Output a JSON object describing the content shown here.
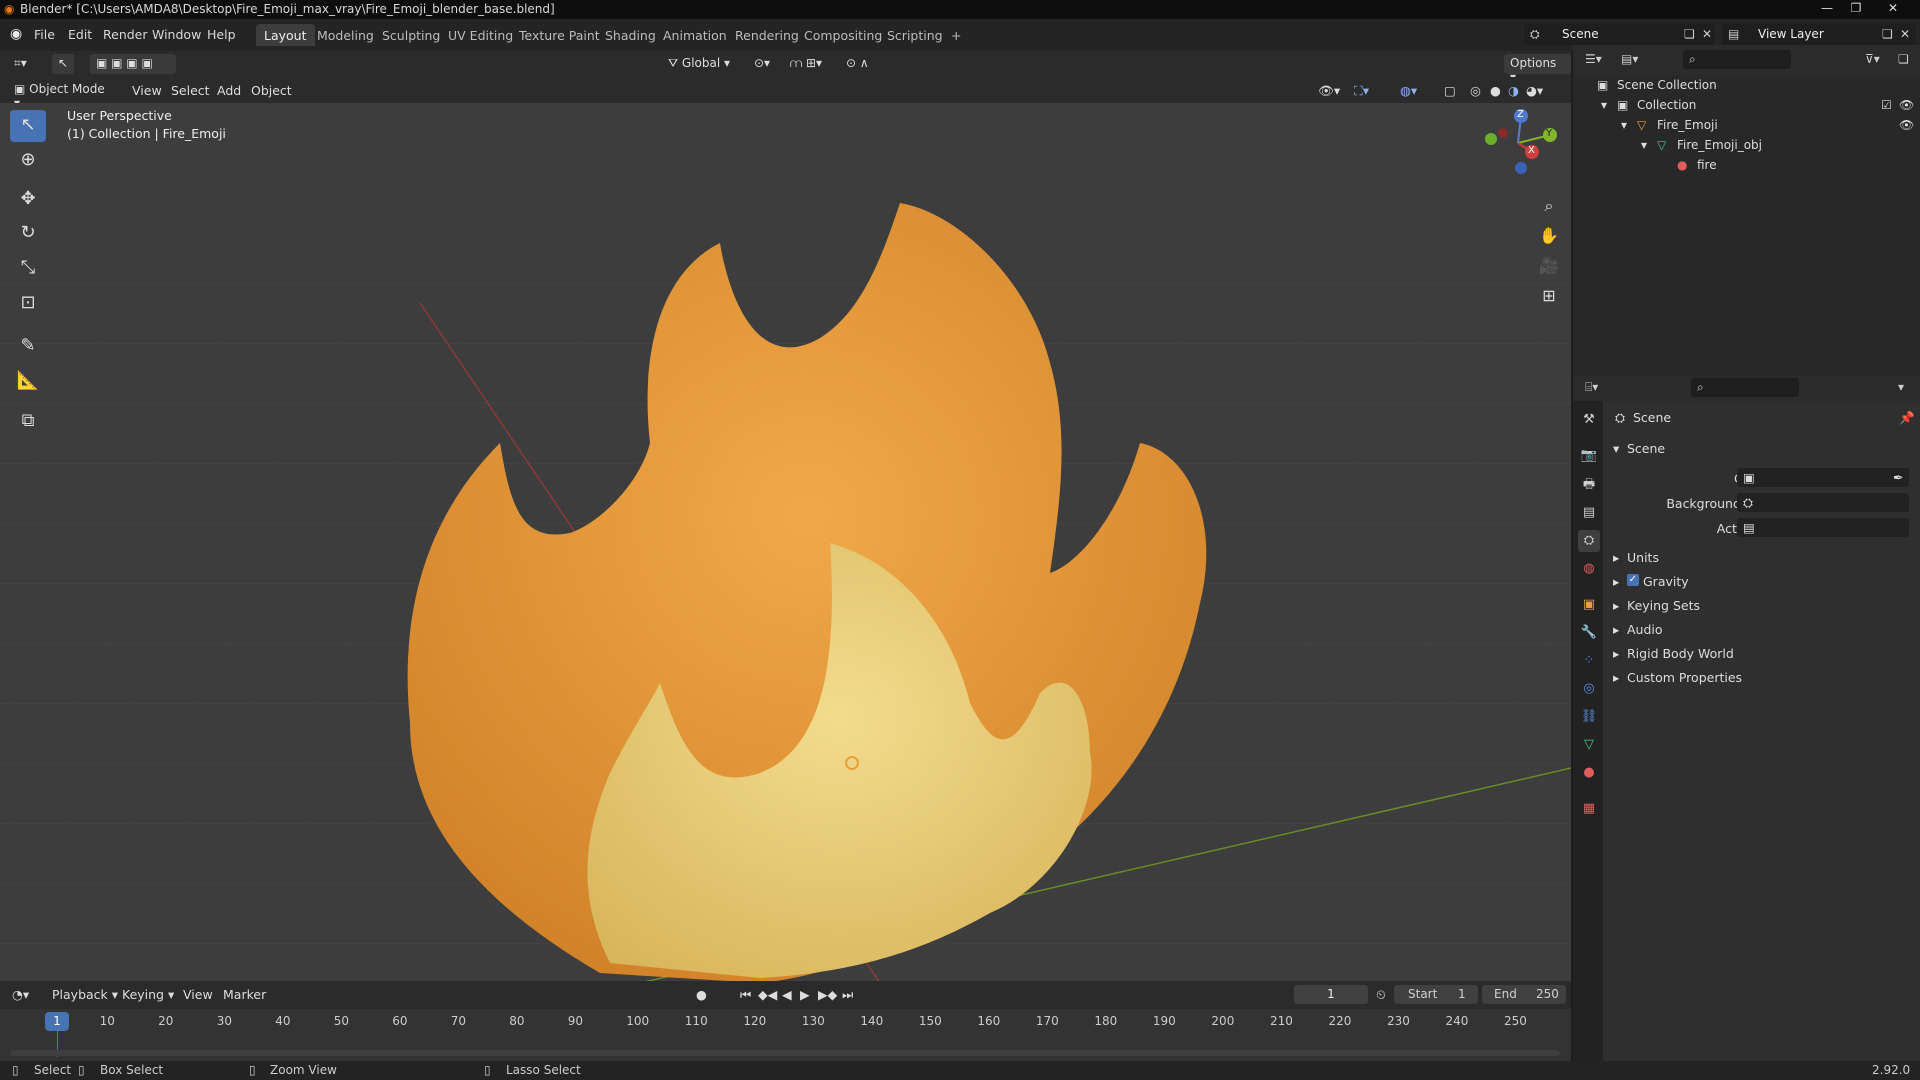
{
  "title_bar": {
    "title": "Blender* [C:\\Users\\AMDA8\\Desktop\\Fire_Emoji_max_vray\\Fire_Emoji_blender_base.blend]",
    "min": "—",
    "max": "❐",
    "close": "✕"
  },
  "menu": {
    "items": [
      "File",
      "Edit",
      "Render",
      "Window",
      "Help"
    ],
    "workspaces": [
      "Layout",
      "Modeling",
      "Sculpting",
      "UV Editing",
      "Texture Paint",
      "Shading",
      "Animation",
      "Rendering",
      "Compositing",
      "Scripting"
    ],
    "add_tab": "+",
    "scene": "Scene",
    "view_layer": "View Layer"
  },
  "tool_header": {
    "transform": "Global",
    "options": "Options"
  },
  "viewport_header": {
    "mode": "Object Mode",
    "menus": [
      "View",
      "Select",
      "Add",
      "Object"
    ]
  },
  "viewport": {
    "perspective": "User Perspective",
    "collection": "(1) Collection | Fire_Emoji",
    "gizmo": {
      "z": "Z",
      "y": "Y",
      "x": "X"
    },
    "object_colors": {
      "outer": "#e39a3c",
      "inner": "#e9cc78",
      "background": "#3d3d3d"
    }
  },
  "outliner": {
    "scene_collection": "Scene Collection",
    "collection": "Collection",
    "object": "Fire_Emoji",
    "mesh": "Fire_Emoji_obj",
    "material": "fire"
  },
  "properties": {
    "context": "Scene",
    "panel": "Scene",
    "camera_label": "Camera",
    "background_scene_label": "Background Scene",
    "active_clip_label": "Active Clip",
    "sections": [
      "Units",
      "Gravity",
      "Keying Sets",
      "Audio",
      "Rigid Body World",
      "Custom Properties"
    ]
  },
  "timeline": {
    "menus": [
      "Playback",
      "Keying",
      "View",
      "Marker"
    ],
    "current_frame": "1",
    "start_label": "Start",
    "start": "1",
    "end_label": "End",
    "end": "250",
    "ticks": [
      "1",
      "10",
      "20",
      "30",
      "40",
      "50",
      "60",
      "70",
      "80",
      "90",
      "100",
      "110",
      "120",
      "130",
      "140",
      "150",
      "160",
      "170",
      "180",
      "190",
      "200",
      "210",
      "220",
      "230",
      "240",
      "250"
    ]
  },
  "status_bar": {
    "select": "Select",
    "box_select": "Box Select",
    "zoom_view": "Zoom View",
    "lasso_select": "Lasso Select",
    "version": "2.92.0"
  }
}
